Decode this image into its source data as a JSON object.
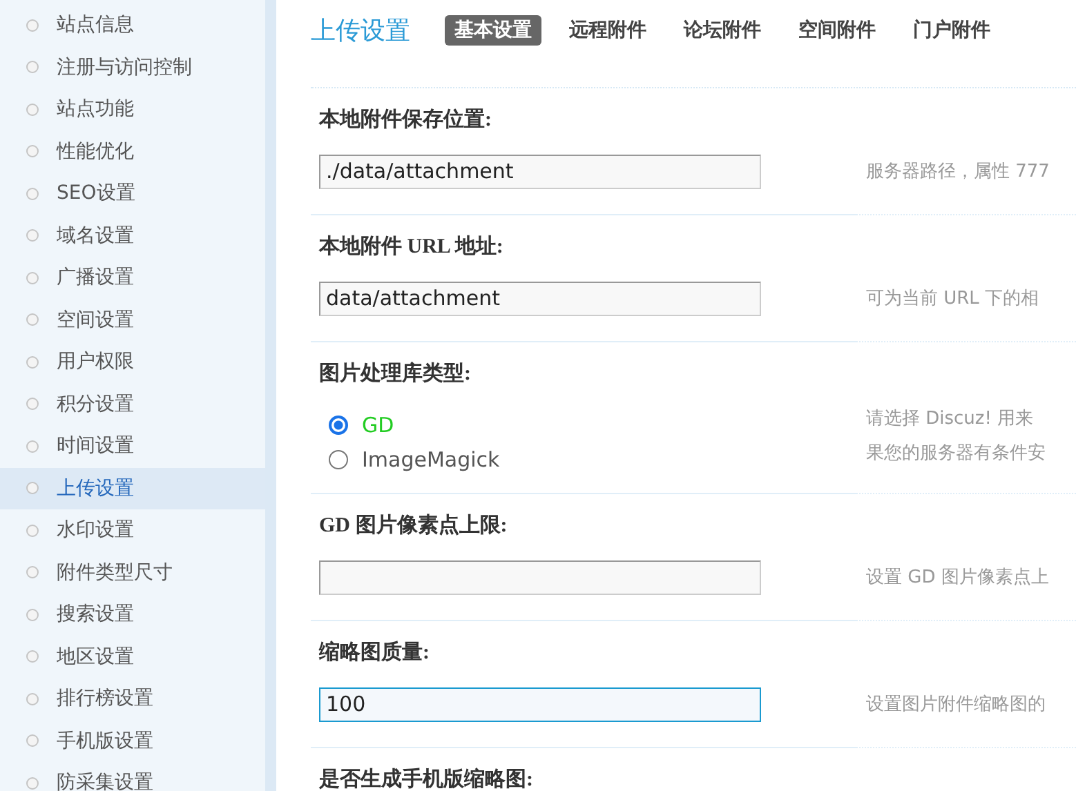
{
  "sidebar": {
    "items": [
      {
        "label": "站点信息",
        "selected": false
      },
      {
        "label": "注册与访问控制",
        "selected": false
      },
      {
        "label": "站点功能",
        "selected": false
      },
      {
        "label": "性能优化",
        "selected": false
      },
      {
        "label": "SEO设置",
        "selected": false
      },
      {
        "label": "域名设置",
        "selected": false
      },
      {
        "label": "广播设置",
        "selected": false
      },
      {
        "label": "空间设置",
        "selected": false
      },
      {
        "label": "用户权限",
        "selected": false
      },
      {
        "label": "积分设置",
        "selected": false
      },
      {
        "label": "时间设置",
        "selected": false
      },
      {
        "label": "上传设置",
        "selected": true
      },
      {
        "label": "水印设置",
        "selected": false
      },
      {
        "label": "附件类型尺寸",
        "selected": false
      },
      {
        "label": "搜索设置",
        "selected": false
      },
      {
        "label": "地区设置",
        "selected": false
      },
      {
        "label": "排行榜设置",
        "selected": false
      },
      {
        "label": "手机版设置",
        "selected": false
      },
      {
        "label": "防采集设置",
        "selected": false
      }
    ]
  },
  "header": {
    "title": "上传设置",
    "tabs": [
      {
        "label": "基本设置",
        "selected": true
      },
      {
        "label": "远程附件",
        "selected": false
      },
      {
        "label": "论坛附件",
        "selected": false
      },
      {
        "label": "空间附件",
        "selected": false
      },
      {
        "label": "门户附件",
        "selected": false
      }
    ]
  },
  "settings": [
    {
      "kind": "text",
      "label": "本地附件保存位置:",
      "value": "./data/attachment",
      "focused": false,
      "hint": [
        "服务器路径，属性 777"
      ]
    },
    {
      "kind": "text",
      "label": "本地附件 URL 地址:",
      "value": "data/attachment",
      "focused": false,
      "hint": [
        "可为当前 URL 下的相"
      ]
    },
    {
      "kind": "radio",
      "label": "图片处理库类型:",
      "options": [
        {
          "label": "GD",
          "selected": true
        },
        {
          "label": "ImageMagick",
          "selected": false
        }
      ],
      "hint": [
        "请选择 Discuz! 用来",
        "果您的服务器有条件安"
      ]
    },
    {
      "kind": "text",
      "label": "GD 图片像素点上限:",
      "focused": false,
      "hint": [
        "设置 GD 图片像素点上"
      ]
    },
    {
      "kind": "text",
      "label": "缩略图质量:",
      "value": "100",
      "focused": true,
      "hint": [
        "设置图片附件缩略图的"
      ]
    },
    {
      "kind": "heading",
      "label": "是否生成手机版缩略图:"
    }
  ]
}
